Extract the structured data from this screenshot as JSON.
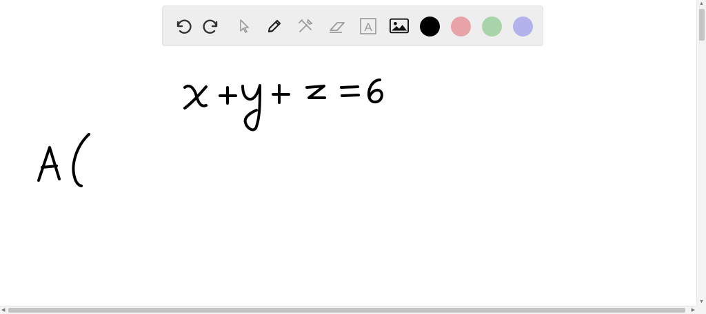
{
  "toolbar": {
    "tools": [
      {
        "name": "undo",
        "icon": "undo-icon"
      },
      {
        "name": "redo",
        "icon": "redo-icon"
      },
      {
        "name": "select",
        "icon": "pointer-icon"
      },
      {
        "name": "pen",
        "icon": "pen-icon"
      },
      {
        "name": "tools",
        "icon": "tools-icon"
      },
      {
        "name": "eraser",
        "icon": "eraser-icon"
      },
      {
        "name": "text",
        "icon": "text-box-icon"
      },
      {
        "name": "image",
        "icon": "image-icon"
      }
    ],
    "text_tool_glyph": "A",
    "colors": [
      "#000000",
      "#e8a3a8",
      "#a9d4a9",
      "#b3b3ec"
    ]
  },
  "canvas": {
    "handwriting": [
      "x + y + z = 6",
      "A("
    ]
  },
  "scrollbars": {
    "up_arrow": "▲",
    "down_arrow": "▼",
    "left_arrow": "◀",
    "right_arrow": "▶"
  }
}
